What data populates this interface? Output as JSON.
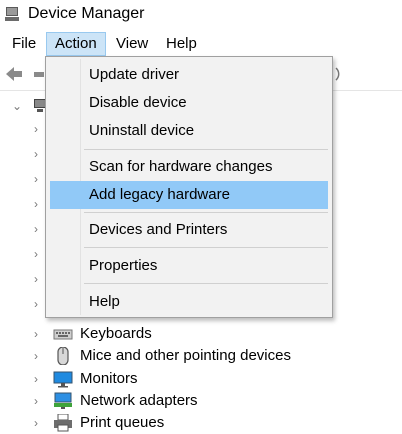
{
  "window": {
    "title": "Device Manager"
  },
  "menubar": {
    "items": [
      {
        "label": "File"
      },
      {
        "label": "Action"
      },
      {
        "label": "View"
      },
      {
        "label": "Help"
      }
    ]
  },
  "action_menu": {
    "items": [
      {
        "label": "Update driver"
      },
      {
        "label": "Disable device"
      },
      {
        "label": "Uninstall device"
      },
      {
        "label": "Scan for hardware changes"
      },
      {
        "label": "Add legacy hardware"
      },
      {
        "label": "Devices and Printers"
      },
      {
        "label": "Properties"
      },
      {
        "label": "Help"
      }
    ],
    "highlighted": "Add legacy hardware"
  },
  "tree": {
    "visible_devices": [
      {
        "label": "Keyboards",
        "icon": "keyboard-icon"
      },
      {
        "label": "Mice and other pointing devices",
        "icon": "mouse-icon"
      },
      {
        "label": "Monitors",
        "icon": "monitor-icon"
      },
      {
        "label": "Network adapters",
        "icon": "network-adapter-icon"
      },
      {
        "label": "Print queues",
        "icon": "printer-icon"
      }
    ]
  },
  "colors": {
    "menu_active_bg": "#cce4f7",
    "menu_hover_bg": "#91c9f7",
    "menu_bg": "#f2f2f2"
  }
}
